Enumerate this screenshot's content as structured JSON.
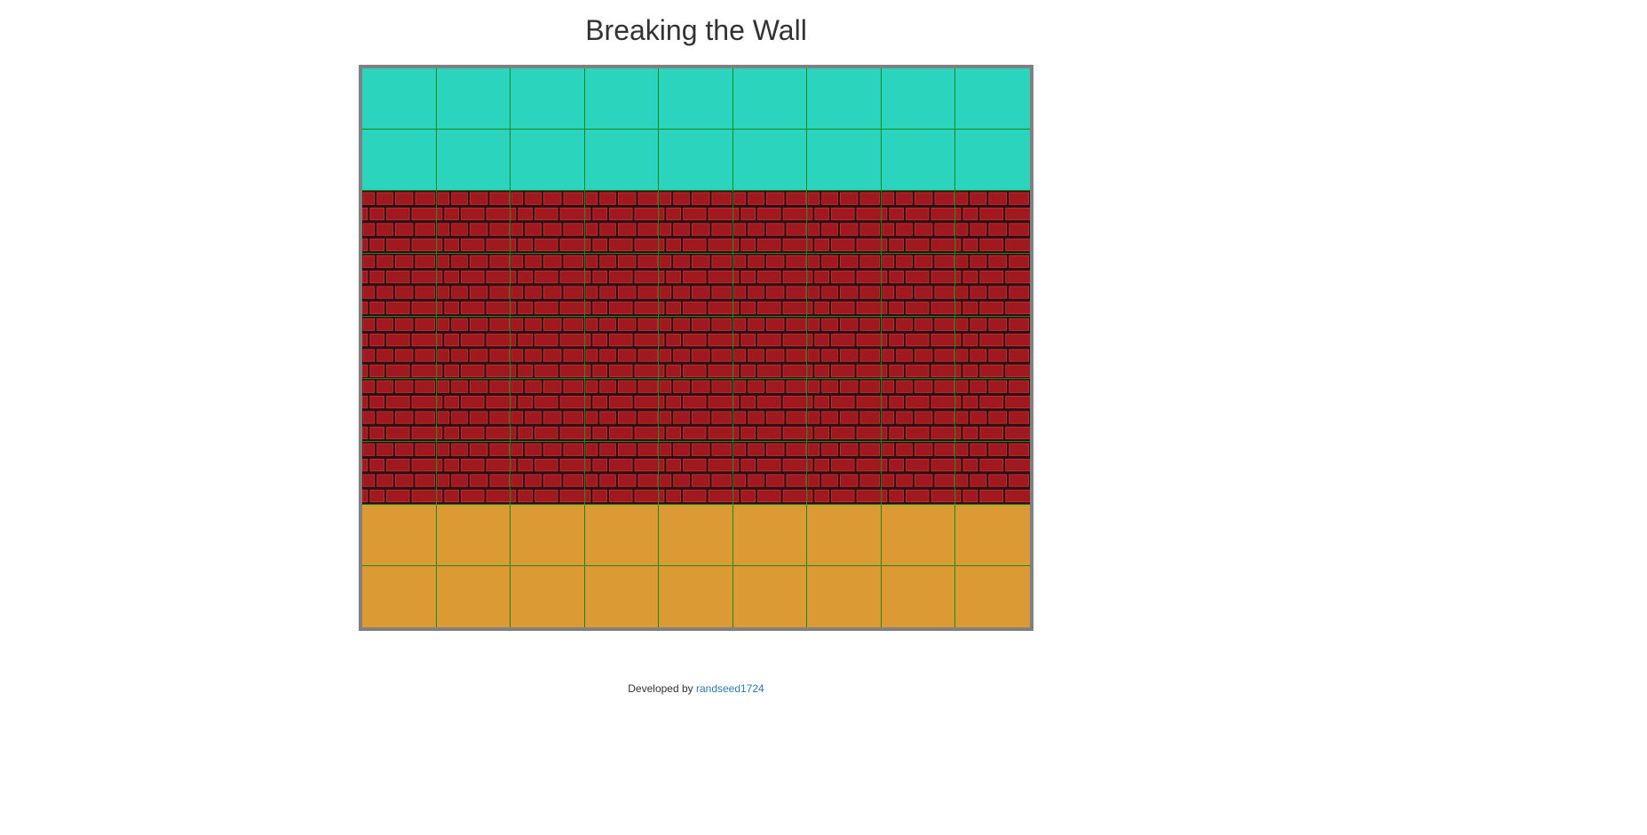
{
  "page": {
    "title": "Breaking the Wall"
  },
  "board": {
    "columns": 9,
    "rows": [
      "water",
      "water",
      "wall",
      "wall",
      "wall",
      "wall",
      "wall",
      "sand",
      "sand"
    ],
    "colors": {
      "water": "#2bd4bd",
      "sand": "#dc9a34",
      "brick": "#a0191f",
      "mortar": "#2a1010",
      "grid_line": "#1b8a1b",
      "frame": "#808080"
    },
    "tile_names": {
      "water": "water-tile",
      "wall": "brick-wall-tile",
      "sand": "sand-tile"
    }
  },
  "footer": {
    "prefix": "Developed by ",
    "author_link": "randseed1724"
  }
}
